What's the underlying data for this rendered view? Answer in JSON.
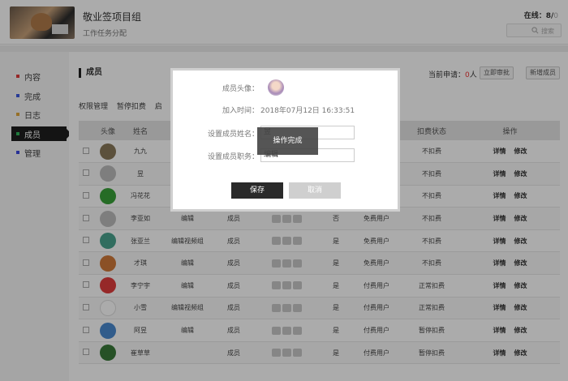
{
  "header": {
    "team_name": "敬业签项目组",
    "team_sub": "工作任务分配",
    "online_label": "在线：",
    "online_count": "8",
    "online_sep": "/",
    "online_total": "0",
    "search_placeholder": "搜索"
  },
  "sidebar": {
    "items": [
      {
        "label": "内容",
        "color": "#e03c3c"
      },
      {
        "label": "完成",
        "color": "#3c5ae0"
      },
      {
        "label": "日志",
        "color": "#e0a83c"
      },
      {
        "label": "成员",
        "color": "#2fb55a",
        "active": true
      },
      {
        "label": "管理",
        "color": "#3c4ae0"
      }
    ]
  },
  "main": {
    "section_title": "成员",
    "apply_label": "当前申请：",
    "apply_count": "0",
    "apply_unit": "人",
    "btn_review": "立即审批",
    "btn_add": "新增成员",
    "tabs": [
      "权限管理",
      "暂停扣费",
      "启"
    ],
    "columns": [
      "头像",
      "姓名",
      "",
      "",
      "",
      "",
      "",
      "扣费状态",
      "操作"
    ],
    "rows": [
      {
        "name": "九九",
        "group": "",
        "role": "",
        "agree": "",
        "user_type": "",
        "fee": "不扣费",
        "avatar_color": "#8a7a5a"
      },
      {
        "name": "昱",
        "group": "",
        "role": "",
        "agree": "",
        "user_type": "",
        "fee": "不扣费",
        "avatar_color": "#bdbdbd"
      },
      {
        "name": "冯花花",
        "group": "",
        "role": "",
        "agree": "",
        "user_type": "",
        "fee": "不扣费",
        "avatar_color": "#3aa13a"
      },
      {
        "name": "李亚如",
        "group": "编辑",
        "role": "成员",
        "agree": "否",
        "user_type": "免费用户",
        "fee": "不扣费",
        "avatar_color": "#bdbdbd"
      },
      {
        "name": "张亚兰",
        "group": "编辑视频组",
        "role": "成员",
        "agree": "是",
        "user_type": "免费用户",
        "fee": "不扣费",
        "avatar_color": "#4aa38e"
      },
      {
        "name": "才琪",
        "group": "编辑",
        "role": "成员",
        "agree": "是",
        "user_type": "免费用户",
        "fee": "不扣费",
        "avatar_color": "#d07a3a"
      },
      {
        "name": "李宁宇",
        "group": "编辑",
        "role": "成员",
        "agree": "是",
        "user_type": "付费用户",
        "fee": "正常扣费",
        "avatar_color": "#e03c3c"
      },
      {
        "name": "小雪",
        "group": "编辑视频组",
        "role": "成员",
        "agree": "是",
        "user_type": "付费用户",
        "fee": "正常扣费",
        "avatar_color": "#ffffff"
      },
      {
        "name": "阿昱",
        "group": "编辑",
        "role": "成员",
        "agree": "是",
        "user_type": "付费用户",
        "fee": "暂停扣费",
        "avatar_color": "#4a8ad0"
      },
      {
        "name": "崔草草",
        "group": "",
        "role": "成员",
        "agree": "是",
        "user_type": "付费用户",
        "fee": "暂停扣费",
        "avatar_color": "#3a7a3a"
      }
    ],
    "action_edit": "详情",
    "action_modify": "修改"
  },
  "modal": {
    "avatar_label": "成员头像：",
    "join_label": "加入时间：",
    "join_time": "2018年07月12日 16:33:51",
    "name_label": "设置成员姓名：",
    "name_value": "昱",
    "role_label": "设置成员职务：",
    "role_value": "编辑",
    "toast": "操作完成",
    "save": "保存",
    "cancel": "取消"
  }
}
